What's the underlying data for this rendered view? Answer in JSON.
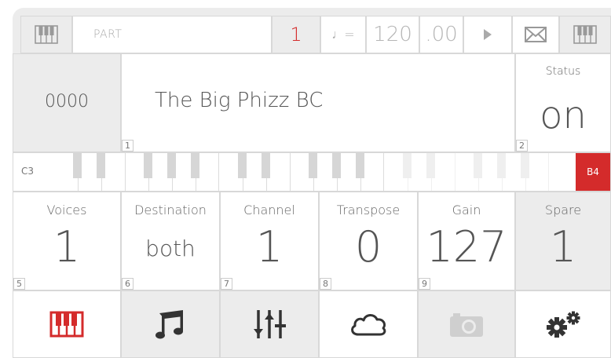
{
  "header": {
    "part_label": "PART",
    "part_number": "1",
    "tempo_symbol": "♩=",
    "tempo_value": "120",
    "tempo_fraction": ".00"
  },
  "patch": {
    "number": "0000",
    "name": "The Big Phizz BC",
    "name_index": "1",
    "status_label": "Status",
    "status_value": "on",
    "status_index": "2"
  },
  "keyboard": {
    "low_note": "C3",
    "high_note": "B4"
  },
  "params": [
    {
      "label": "Voices",
      "value": "1",
      "index": "5"
    },
    {
      "label": "Destination",
      "value": "both",
      "index": "6"
    },
    {
      "label": "Channel",
      "value": "1",
      "index": "7"
    },
    {
      "label": "Transpose",
      "value": "0",
      "index": "8"
    },
    {
      "label": "Gain",
      "value": "127",
      "index": "9"
    },
    {
      "label": "Spare",
      "value": "1"
    }
  ],
  "colors": {
    "accent": "#d42b2b",
    "panel": "#ececec",
    "text": "#555555"
  },
  "nav_icons": [
    "piano-keys-icon",
    "music-note-icon",
    "mixer-sliders-icon",
    "cloud-icon",
    "camera-icon",
    "gears-icon"
  ]
}
